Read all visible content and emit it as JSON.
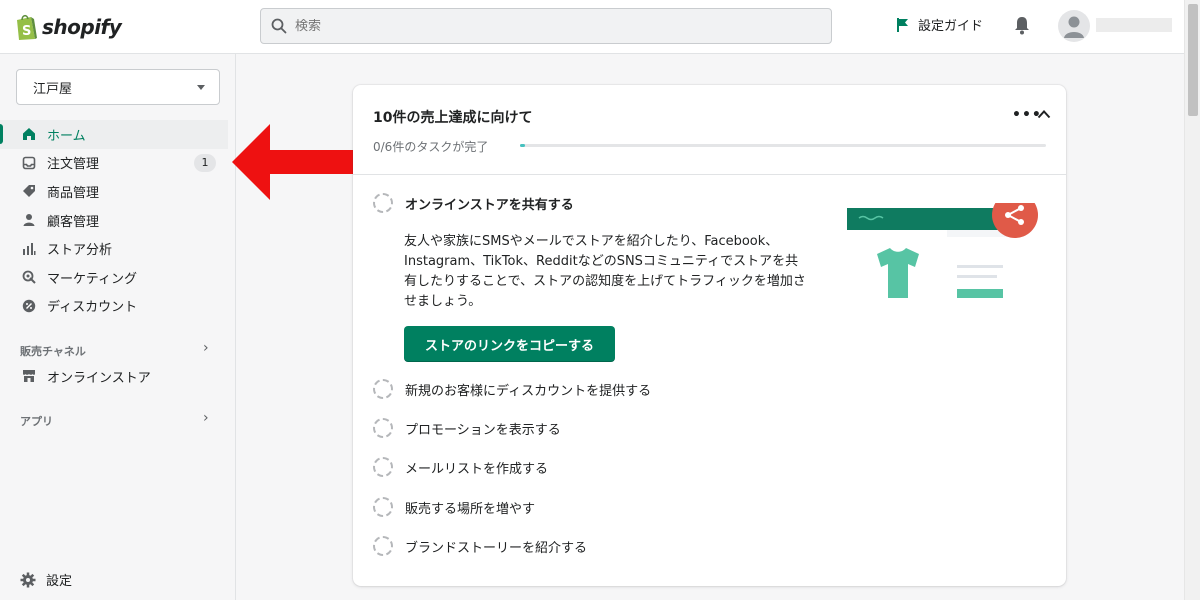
{
  "app": {
    "brand": "shopify"
  },
  "header": {
    "search_placeholder": "検索",
    "setup_guide_label": "設定ガイド",
    "colors": {
      "accent": "#008060",
      "flag": "#008060"
    }
  },
  "sidebar": {
    "store_name": "江戸屋",
    "items": [
      {
        "label": "ホーム",
        "icon": "home-icon",
        "active": true
      },
      {
        "label": "注文管理",
        "icon": "orders-icon",
        "badge": "1"
      },
      {
        "label": "商品管理",
        "icon": "tag-icon"
      },
      {
        "label": "顧客管理",
        "icon": "person-icon"
      },
      {
        "label": "ストア分析",
        "icon": "analytics-icon"
      },
      {
        "label": "マーケティング",
        "icon": "marketing-icon"
      },
      {
        "label": "ディスカウント",
        "icon": "discount-icon"
      }
    ],
    "sales_channels_label": "販売チャネル",
    "online_store_label": "オンラインストア",
    "apps_label": "アプリ",
    "settings_label": "設定"
  },
  "card": {
    "title": "10件の売上達成に向けて",
    "progress_text": "0/6件のタスクが完了",
    "progress_fraction": 0.01,
    "tasks": [
      {
        "label": "オンラインストアを共有する",
        "description": "友人や家族にSMSやメールでストアを紹介したり、Facebook、Instagram、TikTok、RedditなどのSNSコミュニティでストアを共有したりすることで、ストアの認知度を上げてトラフィックを増加させましょう。",
        "button_label": "ストアのリンクをコピーする"
      },
      {
        "label": "新規のお客様にディスカウントを提供する"
      },
      {
        "label": "プロモーションを表示する"
      },
      {
        "label": "メールリストを作成する"
      },
      {
        "label": "販売する場所を増やす"
      },
      {
        "label": "ブランドストーリーを紹介する"
      }
    ]
  }
}
